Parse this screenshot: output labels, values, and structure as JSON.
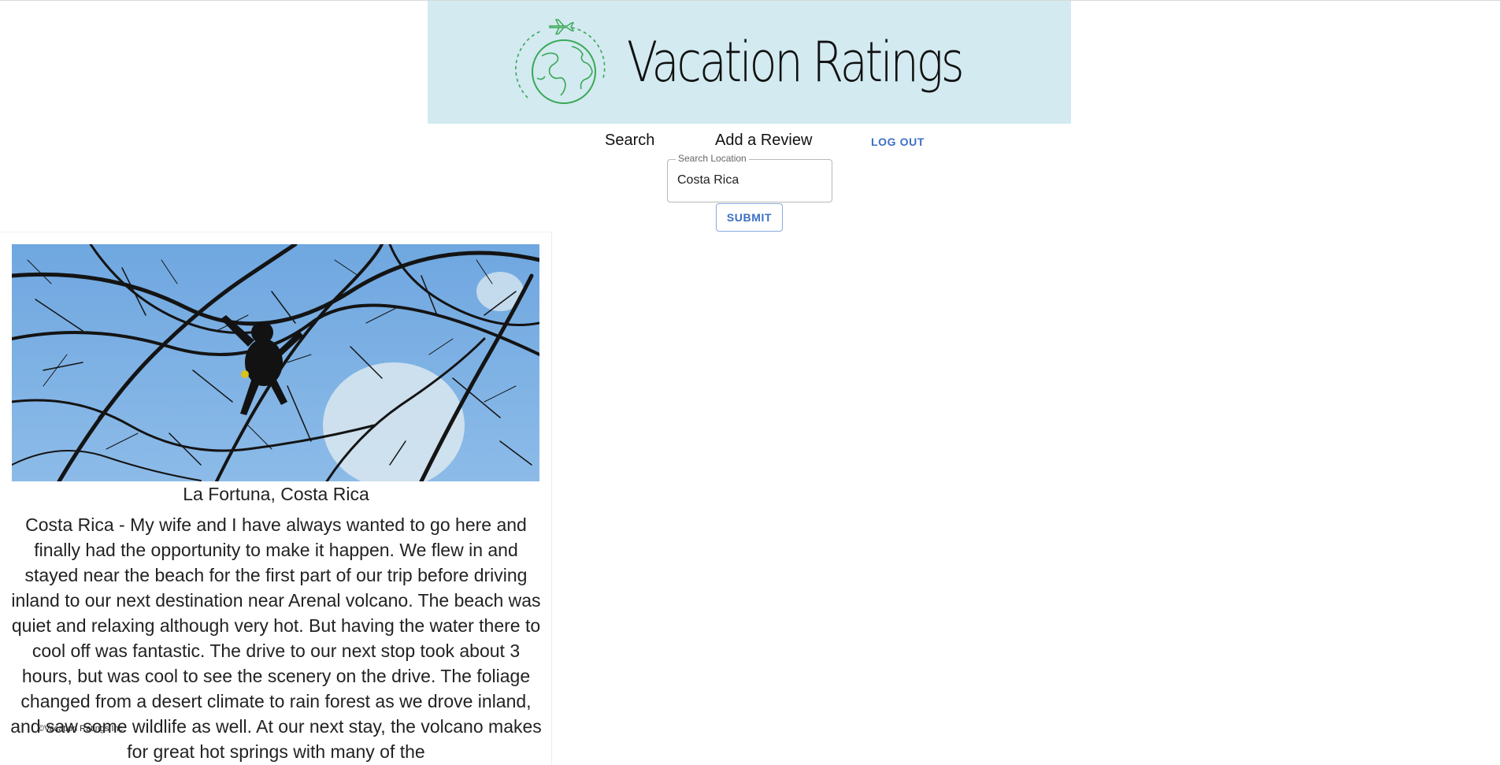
{
  "header": {
    "brand_title": "Vacation Ratings",
    "logo_icon": "globe-airplane-icon",
    "colors": {
      "banner_background": "#d2eaf0",
      "logo_green": "#3aa856"
    }
  },
  "nav": {
    "search_label": "Search",
    "add_review_label": "Add a Review",
    "logout_label": "LOG OUT"
  },
  "search": {
    "legend": "Search Location",
    "value": "Costa Rica",
    "submit_label": "SUBMIT"
  },
  "review": {
    "image_description": "monkey in tree branches",
    "location": "La Fortuna, Costa Rica",
    "text": "Costa Rica - My wife and I have always wanted to go here and finally had the opportunity to make it happen. We flew in and stayed near the beach for the first part of our trip before driving inland to our next destination near Arenal volcano. The beach was quiet and relaxing although very hot. But having the water there to cool off was fantastic. The drive to our next stop took about 3 hours, but was cool to see the scenery on the drive. The foliage changed from a desert climate to rain forest as we drove inland, and saw some wildlife as well. At our next stay, the volcano makes for great hot springs with many of the"
  },
  "footer": {
    "text": "©Vacation Ratings Inc."
  },
  "theme": {
    "accent": "#3b6fc5"
  }
}
